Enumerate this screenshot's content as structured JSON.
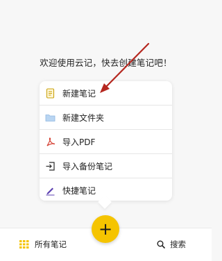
{
  "welcome_text": "欢迎使用云记，快去创建笔记吧！",
  "menu": {
    "items": [
      {
        "label": "新建笔记",
        "icon": "note-icon"
      },
      {
        "label": "新建文件夹",
        "icon": "folder-icon"
      },
      {
        "label": "导入PDF",
        "icon": "pdf-icon"
      },
      {
        "label": "导入备份笔记",
        "icon": "import-backup-icon"
      },
      {
        "label": "快捷笔记",
        "icon": "pen-icon"
      }
    ]
  },
  "fab": {
    "label": "+"
  },
  "bottom_bar": {
    "all_notes_label": "所有笔记",
    "search_label": "搜索"
  },
  "colors": {
    "accent_yellow": "#f5c400",
    "arrow_red": "#b5271f",
    "folder_blue": "#b9d5f2",
    "pdf_red": "#d33a2c",
    "pen_purple": "#5b3fb0"
  }
}
